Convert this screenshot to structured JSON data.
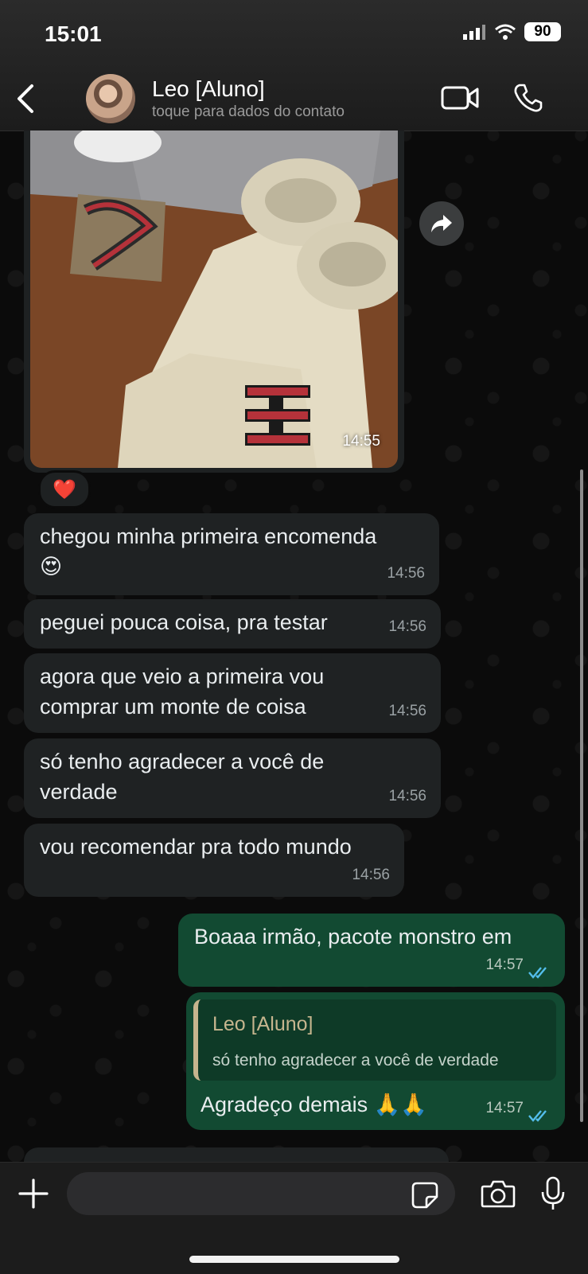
{
  "status_bar": {
    "time": "15:01",
    "battery": "90"
  },
  "header": {
    "contact_name": "Leo [Aluno]",
    "contact_subtitle": "toque para dados do contato"
  },
  "messages": [
    {
      "type": "image",
      "direction": "incoming",
      "time": "14:55",
      "reaction": "❤️"
    },
    {
      "type": "text",
      "direction": "incoming",
      "text": "chegou minha primeira encomenda",
      "emoji": "😍",
      "time": "14:56"
    },
    {
      "type": "text",
      "direction": "incoming",
      "text": "peguei pouca coisa, pra testar",
      "time": "14:56"
    },
    {
      "type": "text",
      "direction": "incoming",
      "text": "agora que veio a primeira vou comprar um monte de coisa",
      "time": "14:56"
    },
    {
      "type": "text",
      "direction": "incoming",
      "text": "só tenho agradecer a você de verdade",
      "time": "14:56"
    },
    {
      "type": "text",
      "direction": "incoming",
      "text": "vou recomendar pra todo mundo",
      "time": "14:56"
    },
    {
      "type": "text",
      "direction": "outgoing",
      "text": "Boaaa irmão, pacote monstro em",
      "time": "14:57",
      "status": "read"
    },
    {
      "type": "reply",
      "direction": "outgoing",
      "quoted_name": "Leo [Aluno]",
      "quoted_text": "só tenho agradecer a você de verdade",
      "text": "Agradeço demais 🙏🙏",
      "time": "14:57",
      "status": "read"
    }
  ],
  "input": {
    "placeholder": ""
  },
  "colors": {
    "incoming": "#1f2223",
    "outgoing": "#124a32",
    "read_ticks": "#53bdeb"
  },
  "icons": [
    "back-icon",
    "video-call-icon",
    "phone-icon",
    "forward-icon",
    "plus-icon",
    "sticker-icon",
    "camera-icon",
    "mic-icon"
  ]
}
